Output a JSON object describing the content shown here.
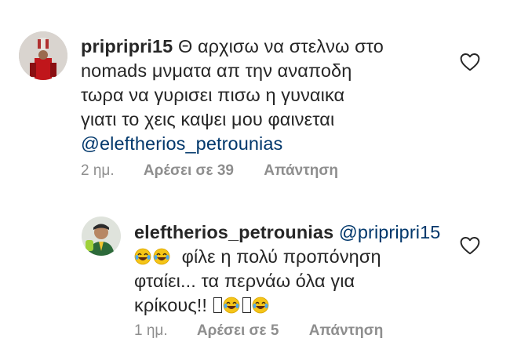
{
  "comments": [
    {
      "username": "pripripri15",
      "lines": [
        "Θ αρχισω να στελνω στο",
        "nomads μνματα απ την αναποδη",
        "τωρα να γυρισει πισω  η γυναικα",
        "γιατι το χεις καψει μου φαινεται"
      ],
      "mention": "@eleftherios_petrounias",
      "time": "2 ημ.",
      "likes": "Αρέσει σε 39",
      "reply": "Απάντηση",
      "avatar_icon": "user-avatar-red-trophy",
      "like_icon": "heart-outline-icon"
    },
    {
      "username": "eleftherios_petrounias",
      "mention": "@pripripri15",
      "line1": "φίλε η πολύ προπόνηση",
      "line2": "φταίει... τα περνάω όλα για",
      "line3": "κρίκους!!",
      "time": "1 ημ.",
      "likes": "Αρέσει σε 5",
      "reply": "Απάντηση",
      "avatar_icon": "user-avatar-green-athlete",
      "like_icon": "heart-outline-icon",
      "emoji_icon": "face-with-tears-of-joy-emoji"
    }
  ],
  "colors": {
    "text": "#262626",
    "meta": "#8e8e8e",
    "mention": "#00376b",
    "emoji": "#f5c518"
  }
}
